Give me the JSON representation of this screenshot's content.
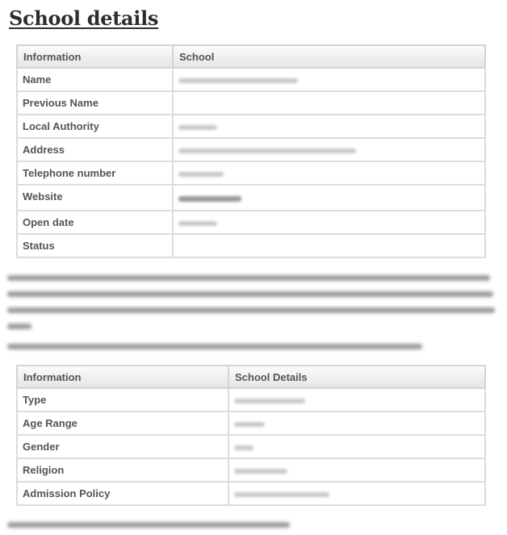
{
  "page": {
    "title": "School details"
  },
  "table1": {
    "headers": [
      "Information",
      "School"
    ],
    "rows": [
      {
        "label": "Name"
      },
      {
        "label": "Previous Name"
      },
      {
        "label": "Local Authority"
      },
      {
        "label": "Address"
      },
      {
        "label": "Telephone number"
      },
      {
        "label": "Website"
      },
      {
        "label": "Open date"
      },
      {
        "label": "Status"
      }
    ]
  },
  "table2": {
    "headers": [
      "Information",
      "School Details"
    ],
    "rows": [
      {
        "label": "Type"
      },
      {
        "label": "Age Range"
      },
      {
        "label": "Gender"
      },
      {
        "label": "Religion"
      },
      {
        "label": "Admission Policy"
      }
    ]
  }
}
